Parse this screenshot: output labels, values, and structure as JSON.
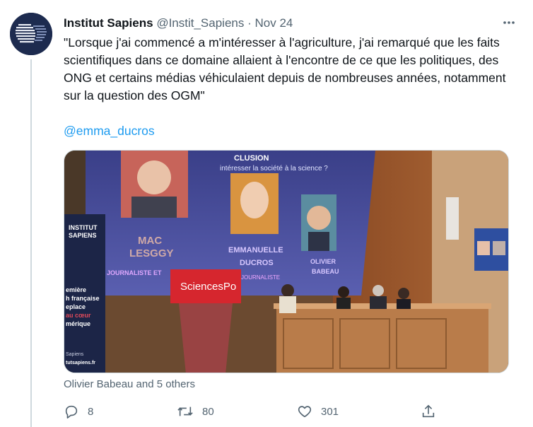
{
  "tweet": {
    "display_name": "Institut Sapiens",
    "handle": "@Instit_Sapiens",
    "separator": "·",
    "date": "Nov 24",
    "text": "\"Lorsque j'ai commencé a m'intéresser à l'agriculture, j'ai remarqué que les faits scientifiques dans ce domaine allaient à l'encontre de ce que les politiques, des ONG et certains médias véhiculaient depuis de nombreuses années, notamment sur la question des OGM\"",
    "mention": "@emma_ducros",
    "social_context": "Olivier Babeau and 5 others"
  },
  "media": {
    "slide_heading": "CLUSION",
    "slide_question": "intéresser la société à la science ?",
    "speakers": [
      {
        "name_line1": "MAC",
        "name_line2": "LESGGY",
        "role": "JOURNALISTE ET"
      },
      {
        "name_line1": "EMMANUELLE",
        "name_line2": "DUCROS",
        "role": "JOURNALISTE"
      },
      {
        "name_line1": "OLIVIER",
        "name_line2": "BABEAU",
        "role": ""
      }
    ],
    "lectern_brand": "SciencesPo",
    "banner_logo_line1": "INSTITUT",
    "banner_logo_line2": "SAPIENS",
    "banner_text": [
      "emière",
      "h française",
      "eplace",
      "au cœur",
      "mérique"
    ],
    "banner_footer_1": "Sapiens",
    "banner_footer_2": "tutsapiens.fr"
  },
  "actions": {
    "reply_count": "8",
    "retweet_count": "80",
    "like_count": "301"
  },
  "icons": {
    "more": "more-horizontal-icon",
    "reply": "reply-icon",
    "retweet": "retweet-icon",
    "like": "heart-icon",
    "share": "share-icon"
  },
  "colors": {
    "accent": "#1d9bf0",
    "text": "#0f1419",
    "secondary": "#536471"
  }
}
